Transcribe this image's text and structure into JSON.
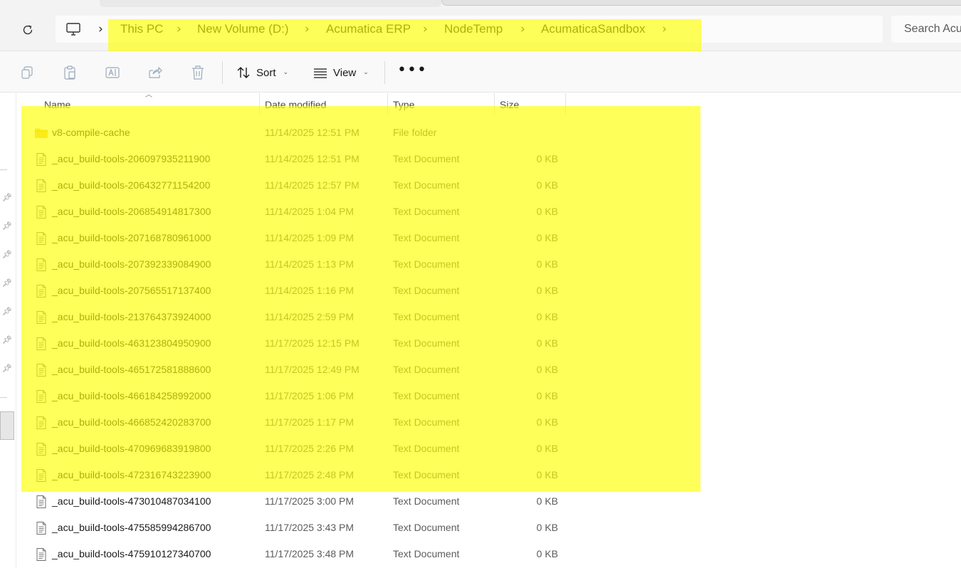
{
  "breadcrumb": {
    "items": [
      {
        "label": "This PC"
      },
      {
        "label": "New Volume (D:)"
      },
      {
        "label": "Acumatica ERP"
      },
      {
        "label": "NodeTemp"
      },
      {
        "label": "AcumaticaSandbox"
      }
    ]
  },
  "search": {
    "placeholder": "Search Acu"
  },
  "toolbar": {
    "sort_label": "Sort",
    "view_label": "View",
    "more_label": "•••"
  },
  "columns": {
    "name": "Name",
    "date": "Date modified",
    "type": "Type",
    "size": "Size"
  },
  "colors": {
    "highlight": "#ffff00",
    "folder": "#f4c64a",
    "accent": "#0067c0"
  },
  "files": [
    {
      "name": "v8-compile-cache",
      "date": "11/14/2025 12:51 PM",
      "type": "File folder",
      "size": "",
      "icon": "folder-icon",
      "highlighted": true
    },
    {
      "name": "_acu_build-tools-206097935211900",
      "date": "11/14/2025 12:51 PM",
      "type": "Text Document",
      "size": "0 KB",
      "icon": "text-file-icon",
      "highlighted": true
    },
    {
      "name": "_acu_build-tools-206432771154200",
      "date": "11/14/2025 12:57 PM",
      "type": "Text Document",
      "size": "0 KB",
      "icon": "text-file-icon",
      "highlighted": true
    },
    {
      "name": "_acu_build-tools-206854914817300",
      "date": "11/14/2025 1:04 PM",
      "type": "Text Document",
      "size": "0 KB",
      "icon": "text-file-icon",
      "highlighted": true
    },
    {
      "name": "_acu_build-tools-207168780961000",
      "date": "11/14/2025 1:09 PM",
      "type": "Text Document",
      "size": "0 KB",
      "icon": "text-file-icon",
      "highlighted": true
    },
    {
      "name": "_acu_build-tools-207392339084900",
      "date": "11/14/2025 1:13 PM",
      "type": "Text Document",
      "size": "0 KB",
      "icon": "text-file-icon",
      "highlighted": true
    },
    {
      "name": "_acu_build-tools-207565517137400",
      "date": "11/14/2025 1:16 PM",
      "type": "Text Document",
      "size": "0 KB",
      "icon": "text-file-icon",
      "highlighted": true
    },
    {
      "name": "_acu_build-tools-213764373924000",
      "date": "11/14/2025 2:59 PM",
      "type": "Text Document",
      "size": "0 KB",
      "icon": "text-file-icon",
      "highlighted": true
    },
    {
      "name": "_acu_build-tools-463123804950900",
      "date": "11/17/2025 12:15 PM",
      "type": "Text Document",
      "size": "0 KB",
      "icon": "text-file-icon",
      "highlighted": true
    },
    {
      "name": "_acu_build-tools-465172581888600",
      "date": "11/17/2025 12:49 PM",
      "type": "Text Document",
      "size": "0 KB",
      "icon": "text-file-icon",
      "highlighted": true
    },
    {
      "name": "_acu_build-tools-466184258992000",
      "date": "11/17/2025 1:06 PM",
      "type": "Text Document",
      "size": "0 KB",
      "icon": "text-file-icon",
      "highlighted": true
    },
    {
      "name": "_acu_build-tools-466852420283700",
      "date": "11/17/2025 1:17 PM",
      "type": "Text Document",
      "size": "0 KB",
      "icon": "text-file-icon",
      "highlighted": true
    },
    {
      "name": "_acu_build-tools-470969683919800",
      "date": "11/17/2025 2:26 PM",
      "type": "Text Document",
      "size": "0 KB",
      "icon": "text-file-icon",
      "highlighted": true
    },
    {
      "name": "_acu_build-tools-472316743223900",
      "date": "11/17/2025 2:48 PM",
      "type": "Text Document",
      "size": "0 KB",
      "icon": "text-file-icon",
      "highlighted": true
    },
    {
      "name": "_acu_build-tools-473010487034100",
      "date": "11/17/2025 3:00 PM",
      "type": "Text Document",
      "size": "0 KB",
      "icon": "text-file-icon",
      "highlighted": false
    },
    {
      "name": "_acu_build-tools-475585994286700",
      "date": "11/17/2025 3:43 PM",
      "type": "Text Document",
      "size": "0 KB",
      "icon": "text-file-icon",
      "highlighted": false
    },
    {
      "name": "_acu_build-tools-475910127340700",
      "date": "11/17/2025 3:48 PM",
      "type": "Text Document",
      "size": "0 KB",
      "icon": "text-file-icon",
      "highlighted": false
    }
  ]
}
